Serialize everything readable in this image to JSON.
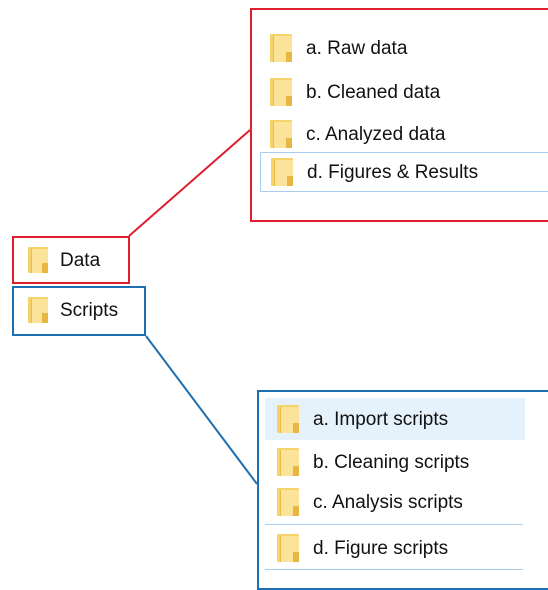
{
  "root_folders": [
    {
      "label": "Data"
    },
    {
      "label": "Scripts"
    }
  ],
  "data_subfolders": [
    {
      "label": "a. Raw data"
    },
    {
      "label": "b. Cleaned data"
    },
    {
      "label": "c. Analyzed data"
    },
    {
      "label": "d. Figures & Results"
    }
  ],
  "scripts_subfolders": [
    {
      "label": "a. Import scripts"
    },
    {
      "label": "b. Cleaning scripts"
    },
    {
      "label": "c. Analysis scripts"
    },
    {
      "label": "d. Figure scripts"
    }
  ],
  "colors": {
    "data_outline": "#e01e2e",
    "scripts_outline": "#1d6fb3",
    "folder_yellow": "#fbe49a",
    "selection_blue": "#a9cdee",
    "hover_blue": "#e5f1fb"
  },
  "icons": {
    "folder": "folder-icon"
  }
}
